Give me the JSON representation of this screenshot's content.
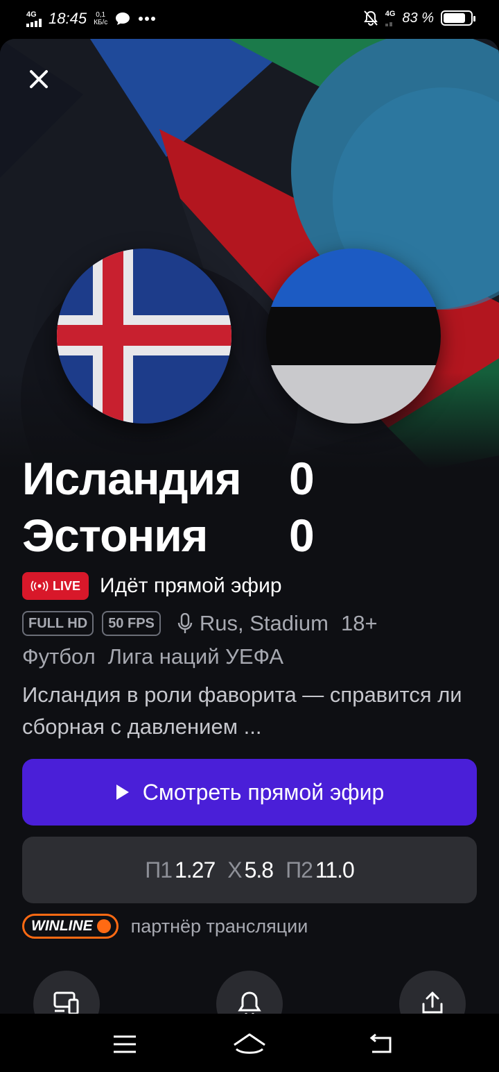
{
  "status_bar": {
    "network": "4G",
    "time": "18:45",
    "speed_value": "0,1",
    "speed_unit": "КБ/с",
    "network_right": "4G",
    "battery": "83 %",
    "battery_level": 0.83,
    "icons": [
      "signal-icon",
      "chat-bubble-icon",
      "more-dots-icon",
      "mute-bell-icon",
      "battery-icon"
    ]
  },
  "match": {
    "team1": {
      "name": "Исландия",
      "score": "0",
      "flag": "iceland-flag"
    },
    "team2": {
      "name": "Эстония",
      "score": "0",
      "flag": "estonia-flag"
    }
  },
  "live": {
    "badge": "LIVE",
    "text": "Идёт прямой эфир",
    "color": "#d8182a"
  },
  "tags": {
    "quality": "FULL HD",
    "fps": "50 FPS",
    "audio": "Rus, Stadium",
    "age": "18+"
  },
  "categories": [
    "Футбол",
    "Лига наций УЕФА"
  ],
  "description": "Исландия в роли фаворита — справится ли сборная с давлением ...",
  "watch_button": {
    "label": "Смотреть прямой эфир",
    "color": "#4a1fd8"
  },
  "odds": {
    "p1_label": "П1",
    "p1_value": "1.27",
    "x_label": "X",
    "x_value": "5.8",
    "p2_label": "П2",
    "p2_value": "11.0"
  },
  "partner": {
    "logo_text": "WINLINE",
    "text": "партнёр трансляции",
    "color": "#ff6a13"
  },
  "actions": [
    "cast-icon",
    "bell-icon",
    "share-icon"
  ],
  "nav": [
    "menu-icon",
    "home-icon",
    "back-icon"
  ]
}
